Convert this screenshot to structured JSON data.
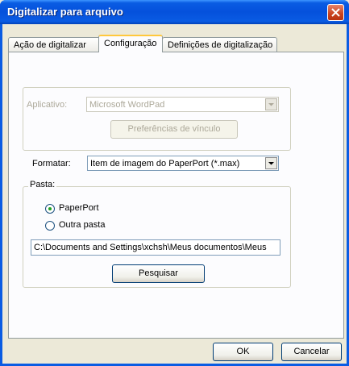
{
  "window": {
    "title": "Digitalizar para arquivo"
  },
  "tabs": [
    {
      "label": "Ação de digitalizar"
    },
    {
      "label": "Configuração"
    },
    {
      "label": "Definições de digitalização"
    }
  ],
  "application": {
    "label": "Aplicativo:",
    "value": "Microsoft WordPad",
    "link_prefs_button": "Preferências de vínculo"
  },
  "format": {
    "label": "Formatar:",
    "value": "Item de imagem do PaperPort (*.max)"
  },
  "folder": {
    "group_label": "Pasta:",
    "option_paperport": "PaperPort",
    "option_other": "Outra pasta",
    "path": "C:\\Documents and Settings\\xchsh\\Meus documentos\\Meus",
    "browse_button": "Pesquisar"
  },
  "dialog": {
    "ok": "OK",
    "cancel": "Cancelar"
  },
  "colors": {
    "title_bar": "#0a5ce3",
    "close_button": "#c8421d",
    "selected_tab_highlight": "#ffc83c",
    "radio_dot": "#21a121"
  }
}
